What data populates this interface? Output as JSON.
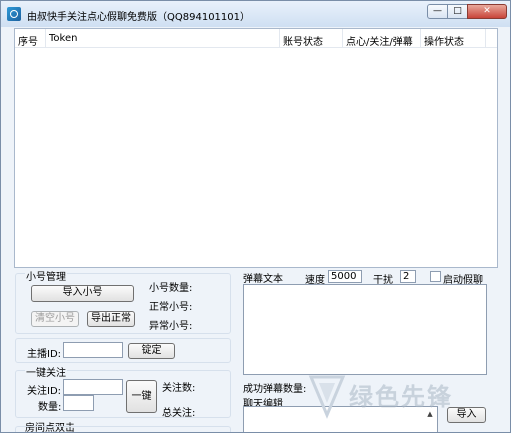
{
  "window": {
    "title": "由叔快手关注点心假聊免费版（QQ894101101）",
    "min_glyph": "—",
    "max_glyph": "□",
    "close_glyph": "✕"
  },
  "table": {
    "columns": [
      "序号",
      "Token",
      "账号状态",
      "点心/关注/弹幕",
      "操作状态"
    ]
  },
  "account_group": {
    "title": "小号管理",
    "import_label": "导入小号",
    "clear_label": "清空小号",
    "export_label": "导出正常",
    "count_label": "小号数量:",
    "normal_label": "正常小号:",
    "abnormal_label": "异常小号:"
  },
  "streamer": {
    "label": "主播ID:",
    "value": "",
    "confirm_label": "锭定"
  },
  "follow_group": {
    "title": "一键关注",
    "id_label": "关注ID:",
    "qty_label": "数量:",
    "id_value": "",
    "qty_value": "",
    "one_click_label": "一键",
    "follow_count_label": "关注数:",
    "total_label": "总关注:"
  },
  "room": {
    "title": "房间点双击"
  },
  "barrage": {
    "label": "弹幕文本",
    "speed_label": "速度",
    "speed_value": "5000",
    "interfere_label": "干扰",
    "interfere_value": "2",
    "fake_chat_label": "启动假聊",
    "success_label": "成功弹幕数量:",
    "chat_edit_label": "聊天编辑",
    "import_label": "导入"
  },
  "watermark": {
    "text": "绿色先锋"
  }
}
